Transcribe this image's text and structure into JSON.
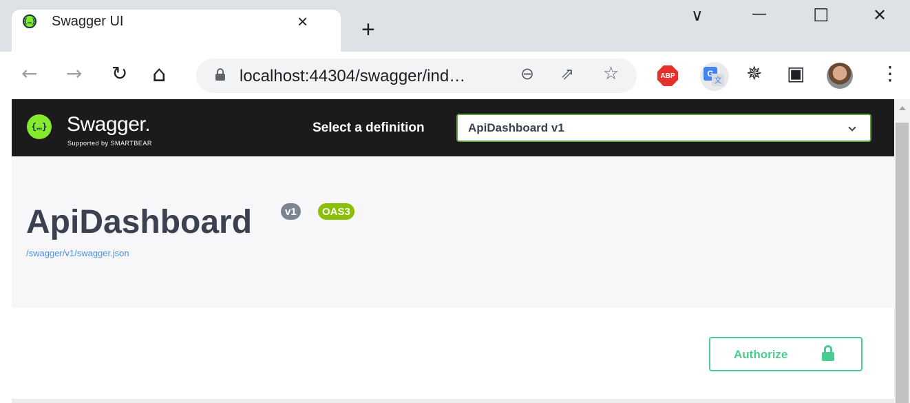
{
  "browser": {
    "tab": {
      "title": "Swagger UI",
      "favicon": "{…}",
      "close_icon": "×"
    },
    "new_tab_icon": "+",
    "window_controls": {
      "dropdown": "∨",
      "minimize": "—",
      "maximize": "☐",
      "close": "✕"
    },
    "nav": {
      "back": "←",
      "forward": "→",
      "reload": "↻",
      "home": "⌂"
    },
    "address": "localhost:44304/swagger/ind…",
    "omnibox_icons": {
      "zoom": "⊖",
      "share": "⇗",
      "bookmark": "☆"
    },
    "extensions": {
      "abp": "ABP",
      "translate_a": "G",
      "translate_b": "文",
      "puzzle": "✵",
      "side_panel": "▣",
      "menu": "⋮"
    }
  },
  "swagger": {
    "logo_glyph": "{…}",
    "brand": "Swagger.",
    "brand_sub": "Supported by SMARTBEAR",
    "definition_label": "Select a definition",
    "definition_value": "ApiDashboard v1"
  },
  "info": {
    "title": "ApiDashboard",
    "version_badge": "v1",
    "oas_badge": "OAS3",
    "spec_link": "/swagger/v1/swagger.json"
  },
  "authorize": {
    "label": "Authorize"
  },
  "colors": {
    "swagger_green": "#85ea2d",
    "authorize_green": "#49cc90",
    "oas_badge": "#89bf04",
    "topbar": "#1b1b1b"
  }
}
